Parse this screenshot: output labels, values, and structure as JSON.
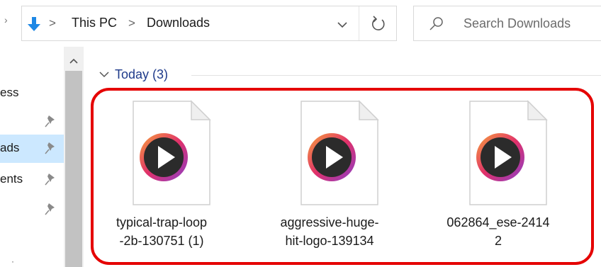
{
  "address_bar": {
    "breadcrumbs": [
      "This PC",
      "Downloads"
    ],
    "separator": ">",
    "dropdown_icon": "chevron-down-icon",
    "refresh_icon": "refresh-icon",
    "nav_icon": "down-arrow-icon"
  },
  "search": {
    "placeholder": "Search Downloads",
    "icon": "search-icon"
  },
  "nav_pane": {
    "items": [
      {
        "label": "ess",
        "pinned": false,
        "selected": false
      },
      {
        "label": "",
        "pinned": true,
        "selected": false
      },
      {
        "label": "ads",
        "pinned": true,
        "selected": true
      },
      {
        "label": "ents",
        "pinned": true,
        "selected": false
      },
      {
        "label": "",
        "pinned": true,
        "selected": false
      }
    ],
    "selected_bg": "#cce8ff"
  },
  "content": {
    "group": {
      "title": "Today (3)",
      "expanded": true
    },
    "highlight_color": "#e50000",
    "files": [
      {
        "name_line1": "typical-trap-loop",
        "name_line2": "-2b-130751 (1)",
        "icon": "media-player-icon"
      },
      {
        "name_line1": "aggressive-huge-",
        "name_line2": "hit-logo-139134",
        "icon": "media-player-icon"
      },
      {
        "name_line1": "062864_ese-2414",
        "name_line2": "2",
        "icon": "media-player-icon"
      }
    ]
  }
}
